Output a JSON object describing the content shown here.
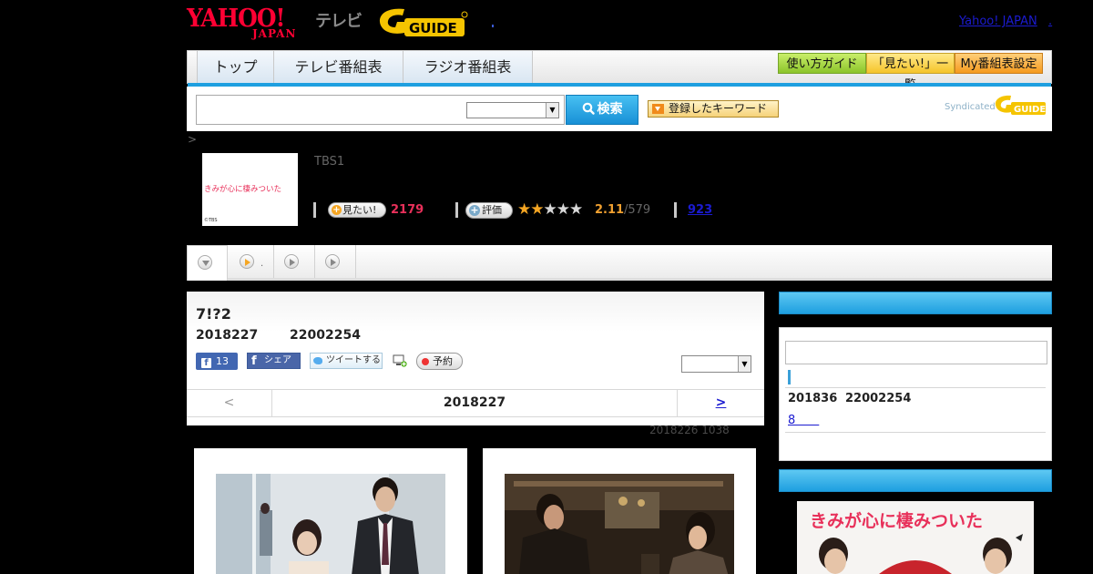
{
  "header": {
    "yahoo_logo": "YAHOO!",
    "yahoo_sub": "JAPAN",
    "terebi": "テレビ",
    "gguide_logo": "GUIDE",
    "yahoo_link": "Yahoo! JAPAN",
    "yahoo_link_suffix": "."
  },
  "nav": {
    "tabs": [
      "トップ",
      "テレビ番組表",
      "ラジオ番組表"
    ],
    "guide_buttons": [
      "使い方ガイド",
      "「見たい!」一覧",
      "My番組表設定"
    ]
  },
  "search": {
    "placeholder": "",
    "button_label": "検索",
    "keyword_button": "登録したキーワード",
    "syndicated": "Syndicated",
    "synd_logo": "GUIDE"
  },
  "program": {
    "breadcrumb": ">",
    "thumb_title": "きみが心に棲みついた",
    "thumb_copyright": "©TBS",
    "channel": "TBS1",
    "mitai_label": "見たい!",
    "mitai_count": "2179",
    "hyoka_label": "評価",
    "rating": "2.11",
    "rating_count": "/579",
    "rating_stars": 2,
    "review_count": "923"
  },
  "tabstrip": {
    "dot": "."
  },
  "episode": {
    "title": "7!?2",
    "date": "2018227",
    "time": "22002254",
    "fb_like_count": "13",
    "fb_share": "シェア",
    "tweet": "ツイートする",
    "reserve": "予約",
    "prev": "<",
    "current": "2018227",
    "next": ">",
    "updated": "2018226  1038"
  },
  "sidebar": {
    "date": "201836",
    "time": "22002254",
    "link": "8　　"
  },
  "poster": {
    "title": "きみが心に棲みついた"
  },
  "colors": {
    "accent_blue": "#1e9fe0",
    "mitai_pink": "#e8305a",
    "star_orange": "#f5a623"
  }
}
